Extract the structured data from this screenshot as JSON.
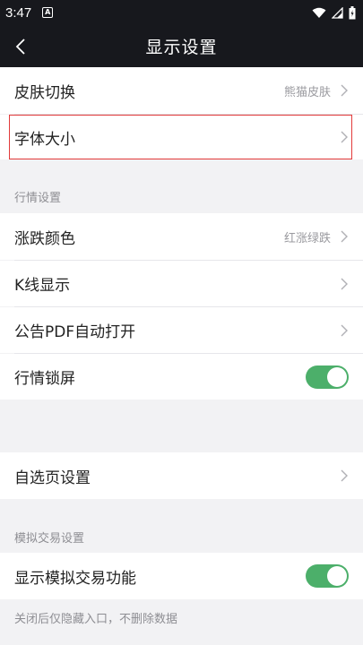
{
  "status_bar": {
    "time": "3:47",
    "notification_glyph": "A",
    "icons": [
      "wifi-icon",
      "signal-icon",
      "battery-icon"
    ]
  },
  "nav": {
    "title": "显示设置",
    "back_icon": "back-chevron-icon"
  },
  "group_top": {
    "items": [
      {
        "label": "皮肤切换",
        "value": "熊猫皮肤"
      },
      {
        "label": "字体大小",
        "value": "",
        "highlighted": true
      }
    ]
  },
  "section_market": {
    "header": "行情设置",
    "items": [
      {
        "label": "涨跌颜色",
        "value": "红涨绿跌"
      },
      {
        "label": "K线显示",
        "value": ""
      },
      {
        "label": "公告PDF自动打开",
        "value": ""
      },
      {
        "label": "行情锁屏",
        "toggle": true
      }
    ]
  },
  "group_watchlist": {
    "items": [
      {
        "label": "自选页设置",
        "value": ""
      }
    ]
  },
  "section_sim": {
    "header": "模拟交易设置",
    "items": [
      {
        "label": "显示模拟交易功能",
        "toggle": true
      }
    ],
    "footnote": "关闭后仅隐藏入口，不删除数据"
  },
  "colors": {
    "nav_bg": "#17181d",
    "toggle_on": "#4caf6a",
    "highlight": "#e23a3a"
  }
}
